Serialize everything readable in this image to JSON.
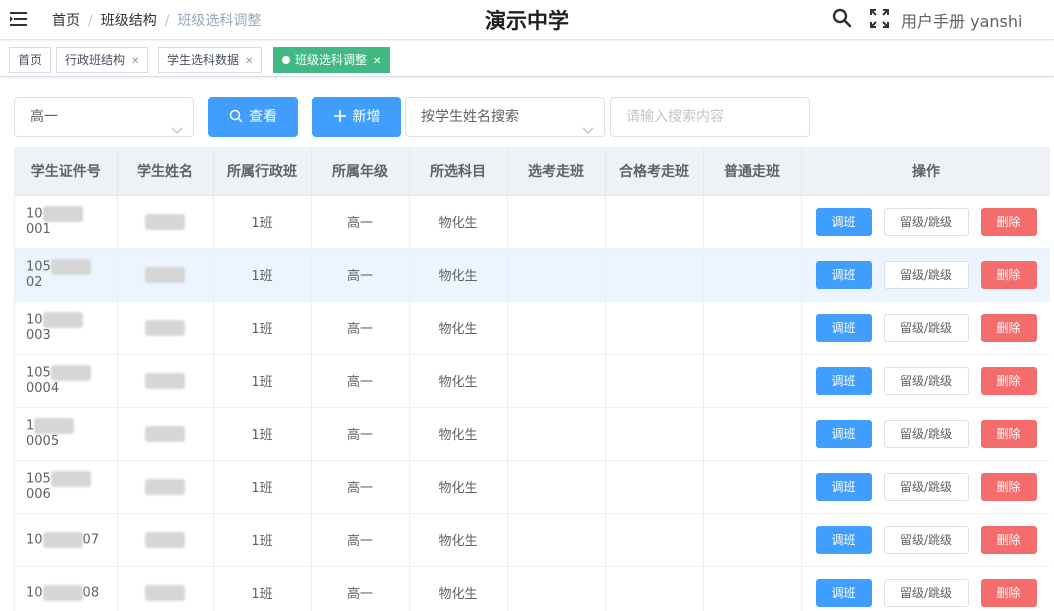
{
  "header": {
    "breadcrumbs": [
      "首页",
      "班级结构",
      "班级选科调整"
    ],
    "title": "演示中学",
    "user_manual": "用户手册",
    "username": "yanshi"
  },
  "tags": [
    {
      "label": "首页",
      "active": false
    },
    {
      "label": "行政班结构",
      "active": false
    },
    {
      "label": "学生选科数据",
      "active": false
    },
    {
      "label": "班级选科调整",
      "active": true
    }
  ],
  "toolbar": {
    "grade_value": "高一",
    "query_label": "查看",
    "add_label": "新增",
    "search_type_value": "按学生姓名搜索",
    "search_placeholder": "请输入搜索内容"
  },
  "table": {
    "headers": [
      "学生证件号",
      "学生姓名",
      "所属行政班",
      "所属年级",
      "所选科目",
      "选考走班",
      "合格考走班",
      "普通走班",
      "操作"
    ],
    "rows": [
      {
        "id_prefix": "10",
        "id_suffix": "001",
        "class": "1班",
        "grade": "高一",
        "subjects": "物化生"
      },
      {
        "id_prefix": "105",
        "id_suffix": "02",
        "class": "1班",
        "grade": "高一",
        "subjects": "物化生"
      },
      {
        "id_prefix": "10",
        "id_suffix": "003",
        "class": "1班",
        "grade": "高一",
        "subjects": "物化生"
      },
      {
        "id_prefix": "105",
        "id_suffix": "0004",
        "class": "1班",
        "grade": "高一",
        "subjects": "物化生"
      },
      {
        "id_prefix": "1",
        "id_suffix": "0005",
        "class": "1班",
        "grade": "高一",
        "subjects": "物化生"
      },
      {
        "id_prefix": "105",
        "id_suffix": "006",
        "class": "1班",
        "grade": "高一",
        "subjects": "物化生"
      },
      {
        "id_prefix": "10",
        "id_suffix": "07",
        "class": "1班",
        "grade": "高一",
        "subjects": "物化生"
      },
      {
        "id_prefix": "10",
        "id_suffix": "08",
        "class": "1班",
        "grade": "高一",
        "subjects": "物化生"
      }
    ],
    "actions": {
      "adjust": "调班",
      "repeat": "留级/跳级",
      "delete": "删除"
    }
  },
  "colors": {
    "primary": "#409eff",
    "active_tag": "#42b983",
    "danger": "#f56c6c",
    "row_highlight": "#ecf5ff"
  },
  "icons": {
    "menu": "menu-fold-icon",
    "search": "search-icon",
    "fullscreen": "fullscreen-icon",
    "chevron": "chevron-down-icon",
    "plus": "plus-icon",
    "magnifier": "search-icon"
  }
}
